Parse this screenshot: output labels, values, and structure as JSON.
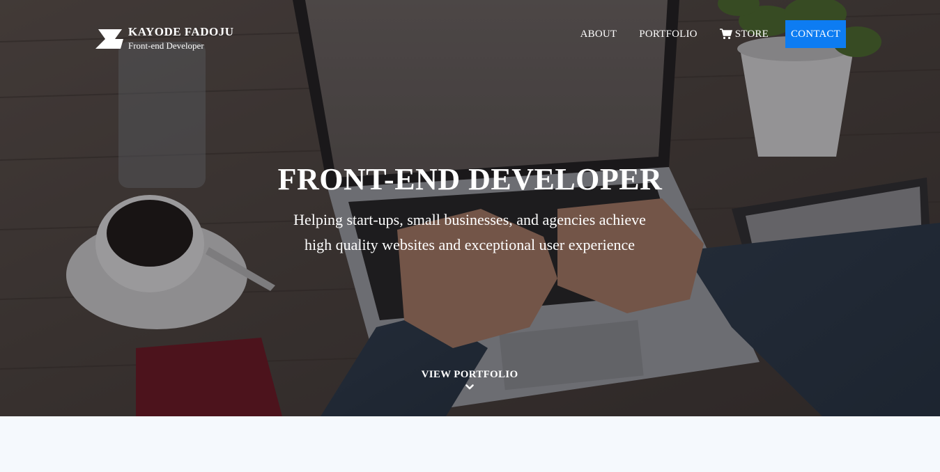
{
  "brand": {
    "name": "KAYODE FADOJU",
    "tagline": "Front-end Developer"
  },
  "nav": {
    "items": [
      {
        "label": "ABOUT"
      },
      {
        "label": "PORTFOLIO"
      },
      {
        "label": "STORE",
        "icon": "cart-icon"
      }
    ],
    "contact_label": "CONTACT"
  },
  "hero": {
    "title": "FRONT-END DEVELOPER",
    "subtitle_line1": "Helping start-ups, small businesses, and agencies achieve",
    "subtitle_line2": "high quality websites and exceptional user experience",
    "cta_label": "VIEW PORTFOLIO",
    "cta_icon": "chevron-down-icon",
    "background": "desk-laptop-photo"
  },
  "colors": {
    "accent": "#0d7cf2",
    "page_background": "#f5f9fd",
    "text": "#ffffff"
  }
}
